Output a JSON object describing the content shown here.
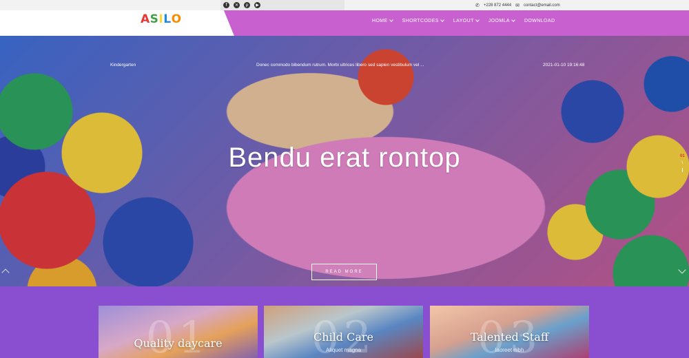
{
  "topbar": {
    "social": [
      {
        "icon": "facebook-icon",
        "glyph": "f"
      },
      {
        "icon": "x-icon",
        "glyph": "✕"
      },
      {
        "icon": "pinterest-icon",
        "glyph": "p"
      },
      {
        "icon": "youtube-icon",
        "glyph": "▶"
      }
    ],
    "phone": "+228 872 4444",
    "email": "contact@email.com"
  },
  "header": {
    "logo_letters": [
      {
        "char": "A",
        "color": "#e53935"
      },
      {
        "char": "S",
        "color": "#43a047"
      },
      {
        "char": "I",
        "color": "#fdd835"
      },
      {
        "char": "L",
        "color": "#1e88e5"
      },
      {
        "char": "O",
        "color": "#fb8c00"
      }
    ],
    "nav": [
      {
        "label": "HOME",
        "has_dropdown": true
      },
      {
        "label": "SHORTCODES",
        "has_dropdown": true
      },
      {
        "label": "LAYOUT",
        "has_dropdown": true
      },
      {
        "label": "JOOMLA",
        "has_dropdown": true
      },
      {
        "label": "DOWNLOAD",
        "has_dropdown": false
      }
    ],
    "nav_color": "#c860d0"
  },
  "hero": {
    "category": "Kindergarten",
    "excerpt": "Donec commodo bibendum rutrum. Morbi ultrices libero sed sapien vestibulum vel ...",
    "datetime": "2021-01-10 19:16:48",
    "title": "Bendu erat rontop",
    "read_more": "READ MORE",
    "pager": {
      "current": "01",
      "sep": "\\"
    }
  },
  "cards": [
    {
      "number": "01",
      "title": "Quality daycare",
      "subtitle": ""
    },
    {
      "number": "02",
      "title": "Child Care",
      "subtitle": "Aliquet magna"
    },
    {
      "number": "03",
      "title": "Talented Staff",
      "subtitle": "laoreet nibh"
    }
  ],
  "colors": {
    "accent": "#8a4fd1",
    "pager_active": "#e2332b"
  }
}
